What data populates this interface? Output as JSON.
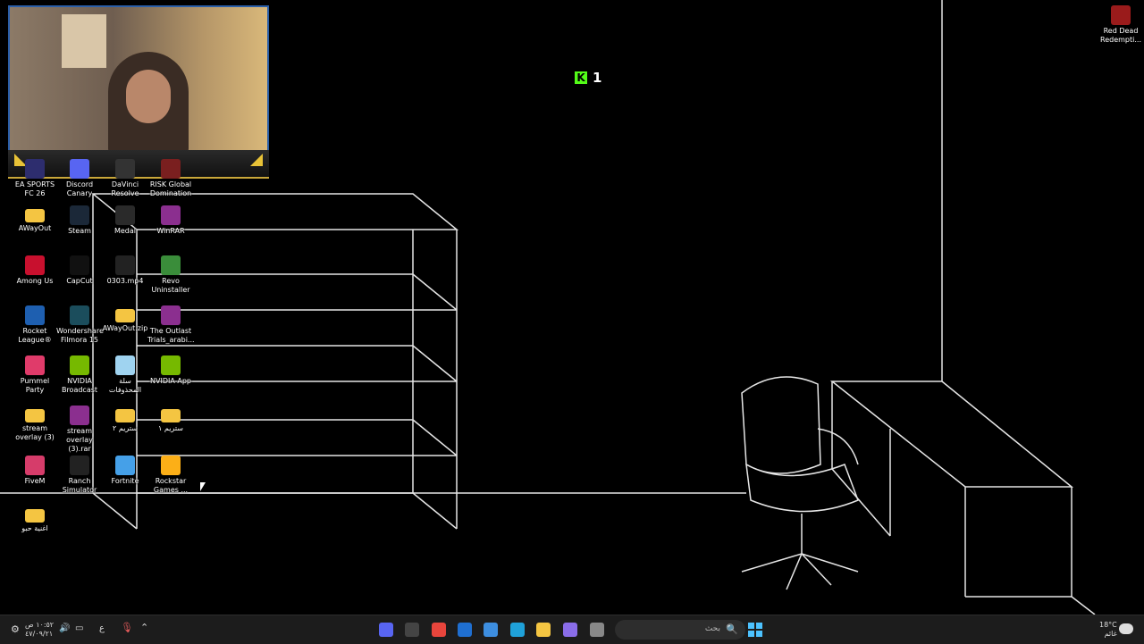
{
  "overlay": {
    "kick_count": "1",
    "kick_logo": "K"
  },
  "desktop": {
    "icons": [
      {
        "label": "EA SPORTS FC 26",
        "color": "#2d2d6e"
      },
      {
        "label": "Discord Canary",
        "color": "#5865f2"
      },
      {
        "label": "DaVinci Resolve",
        "color": "#333"
      },
      {
        "label": "RISK Global Domination",
        "color": "#7a1f1f"
      },
      {
        "label": "AWayOut",
        "color": "#f4c542",
        "folder": true
      },
      {
        "label": "Steam",
        "color": "#1b2838"
      },
      {
        "label": "Medal",
        "color": "#2a2a2a"
      },
      {
        "label": "WinRAR",
        "color": "#8b2f8f"
      },
      {
        "label": "Among Us",
        "color": "#c8102e"
      },
      {
        "label": "CapCut",
        "color": "#111"
      },
      {
        "label": "0303.mp4",
        "color": "#222"
      },
      {
        "label": "Revo Uninstaller",
        "color": "#3a8d3a"
      },
      {
        "label": "Rocket League®",
        "color": "#1e5fb0"
      },
      {
        "label": "Wondershare Filmora 15",
        "color": "#1b4d5c"
      },
      {
        "label": "AWayOut.zip",
        "color": "#f4c542",
        "folder": true
      },
      {
        "label": "The Outlast Trials_arabi...",
        "color": "#8b2f8f"
      },
      {
        "label": "Pummel Party",
        "color": "#e03b6a"
      },
      {
        "label": "NVIDIA Broadcast",
        "color": "#76b900"
      },
      {
        "label": "سلة المحذوفات",
        "color": "#9fd3f0"
      },
      {
        "label": "NVIDIA App",
        "color": "#76b900"
      },
      {
        "label": "stream overlay (3)",
        "color": "#f4c542",
        "folder": true
      },
      {
        "label": "stream overlay (3).rar",
        "color": "#8b2f8f"
      },
      {
        "label": "ستريم ٢",
        "color": "#f4c542",
        "folder": true
      },
      {
        "label": "ستريم ١",
        "color": "#f4c542",
        "folder": true
      },
      {
        "label": "FiveM",
        "color": "#d63c6a"
      },
      {
        "label": "Ranch Simulator",
        "color": "#222"
      },
      {
        "label": "Fortnite",
        "color": "#45a0e8"
      },
      {
        "label": "Rockstar Games ...",
        "color": "#fcaf17"
      },
      {
        "label": "اغنية حبو",
        "color": "#f4c542",
        "folder": true
      },
      {
        "label": "Red Dead Redempti...",
        "color": "#9a1b1b"
      }
    ]
  },
  "taskbar": {
    "search_placeholder": "بحث",
    "search_icon": "🔍",
    "weather_temp": "18°C",
    "weather_desc": "غائم",
    "clock_time": "١٠:٥٢ ص",
    "clock_date": "٤٧/٠٩/٢١",
    "lang": "ع",
    "apps": [
      {
        "name": "discord-icon",
        "color": "#5865f2"
      },
      {
        "name": "davinci-icon",
        "color": "#444"
      },
      {
        "name": "chrome-icon",
        "color": "#e8453c"
      },
      {
        "name": "outlook-icon",
        "color": "#1f6fd1"
      },
      {
        "name": "store-icon",
        "color": "#3d8ee0"
      },
      {
        "name": "edge-icon",
        "color": "#1fa1d9"
      },
      {
        "name": "explorer-icon",
        "color": "#f4c542"
      },
      {
        "name": "copilot-icon",
        "color": "#8a6de9"
      },
      {
        "name": "taskview-icon",
        "color": "#888"
      }
    ]
  }
}
